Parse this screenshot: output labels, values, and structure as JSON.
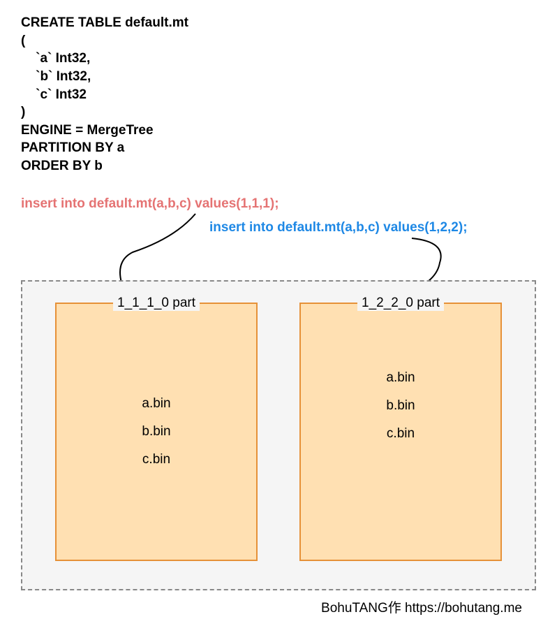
{
  "sql": {
    "line1": "CREATE TABLE default.mt",
    "line2": "(",
    "line3": "    `a` Int32,",
    "line4": "    `b` Int32,",
    "line5": "    `c` Int32",
    "line6": ")",
    "line7": "ENGINE = MergeTree",
    "line8": "PARTITION BY a",
    "line9": "ORDER BY b"
  },
  "inserts": {
    "insert1": "insert into default.mt(a,b,c) values(1,1,1);",
    "insert2": "insert into default.mt(a,b,c) values(1,2,2);"
  },
  "parts": {
    "part1": {
      "title": "1_1_1_0 part",
      "files": [
        "a.bin",
        "b.bin",
        "c.bin"
      ]
    },
    "part2": {
      "title": "1_2_2_0 part",
      "files": [
        "a.bin",
        "b.bin",
        "c.bin"
      ]
    }
  },
  "credit": "BohuTANG作 https://bohutang.me"
}
